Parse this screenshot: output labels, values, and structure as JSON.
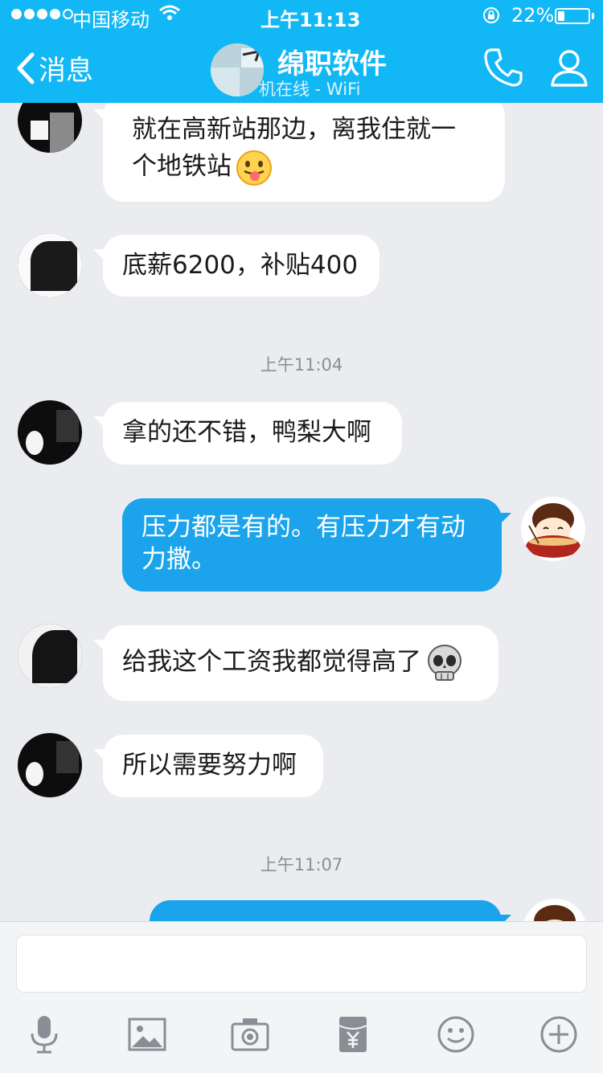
{
  "status_bar": {
    "carrier": "中国移动",
    "time": "上午11:13",
    "battery_pct_label": "22%",
    "battery_level": 0.22
  },
  "nav": {
    "back_label": "消息",
    "title": "绵职软件",
    "subtitle": "机在线 - WiFi"
  },
  "messages": [
    {
      "side": "left",
      "text": "就在高新站那边，离我住就一个地铁站",
      "line1": "就在高新站那边，离我住就一",
      "line2": "个地铁站",
      "emoji": "tongue-face-emoji"
    },
    {
      "side": "left",
      "text": "底薪6200，补贴400"
    },
    {
      "timestamp": "上午11:04"
    },
    {
      "side": "left",
      "text": "拿的还不错，鸭梨大啊"
    },
    {
      "side": "right",
      "line1": "压力都是有的。有压力才有动",
      "line2": "力撒。"
    },
    {
      "side": "left",
      "text": "给我这个工资我都觉得高了",
      "emoji": "skull-emoji"
    },
    {
      "side": "left",
      "text": "所以需要努力啊"
    },
    {
      "timestamp": "上午11:07"
    }
  ],
  "composer": {
    "placeholder": ""
  },
  "toolbar": [
    "mic-icon",
    "image-icon",
    "camera-icon",
    "red-packet-icon",
    "emoji-icon",
    "plus-icon"
  ],
  "colors": {
    "nav_bg": "#12b7f5",
    "my_bubble": "#1ba4eb",
    "chat_bg": "#ebecf0"
  }
}
